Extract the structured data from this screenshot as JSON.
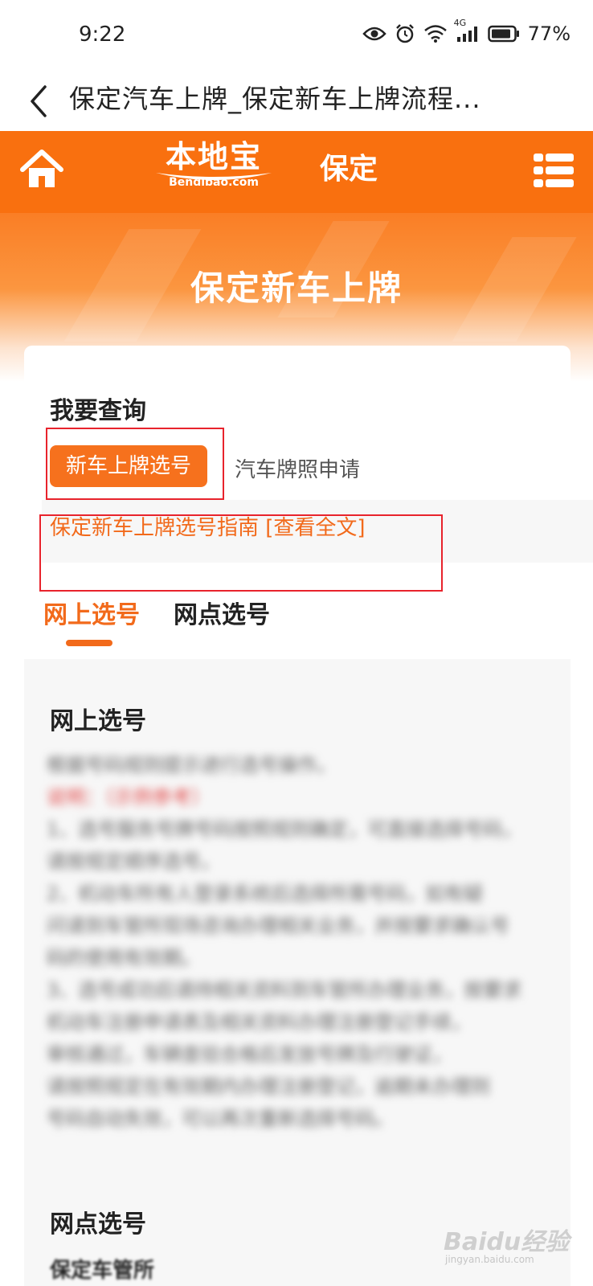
{
  "status_bar": {
    "time": "9:22",
    "network": "4G",
    "battery": "77%"
  },
  "browser": {
    "page_title": "保定汽车上牌_保定新车上牌流程..."
  },
  "site_header": {
    "logo_cn": "本地宝",
    "logo_en": "Bendibao.com",
    "city": "保定",
    "brand_color": "#f9700f"
  },
  "hero": {
    "title": "保定新车上牌"
  },
  "query": {
    "label": "我要查询",
    "options": [
      {
        "label": "新车上牌选号",
        "selected": true
      },
      {
        "label": "汽车牌照申请",
        "selected": false
      }
    ]
  },
  "guide": {
    "link_text": "保定新车上牌选号指南 [查看全文]"
  },
  "tabs": [
    {
      "label": "网上选号",
      "active": true
    },
    {
      "label": "网点选号",
      "active": false
    }
  ],
  "content": {
    "sections": [
      {
        "title": "网上选号",
        "blurred_lines": [
          "根据号码规则提示进行选号操作。",
          "说明：（示例参考）",
          "1、选号服务号牌号码按照规则确定，可直接选择号码，",
          "请按规定顺序选号。",
          "2、机动车所有人登录系统后选择所需号码，如有疑",
          "问请到车管所现场咨询办理相关业务，并按要求确认号",
          "码的使用有效期。",
          "3、选号成功后请持相关资料到车管所办理业务，按要求",
          "机动车注册申请表及相关资料办理注册登记手续，",
          "审核通过，车辆查验合格后发放号牌及行驶证，",
          "请按照规定在有效期内办理注册登记，逾期未办理则",
          "号码自动失效，可以再次重新选择号码。"
        ]
      },
      {
        "title": "网点选号",
        "sub_text": "保定车管所"
      }
    ]
  },
  "watermark": {
    "text": "Baidu经验",
    "sub": "jingyan.baidu.com"
  }
}
